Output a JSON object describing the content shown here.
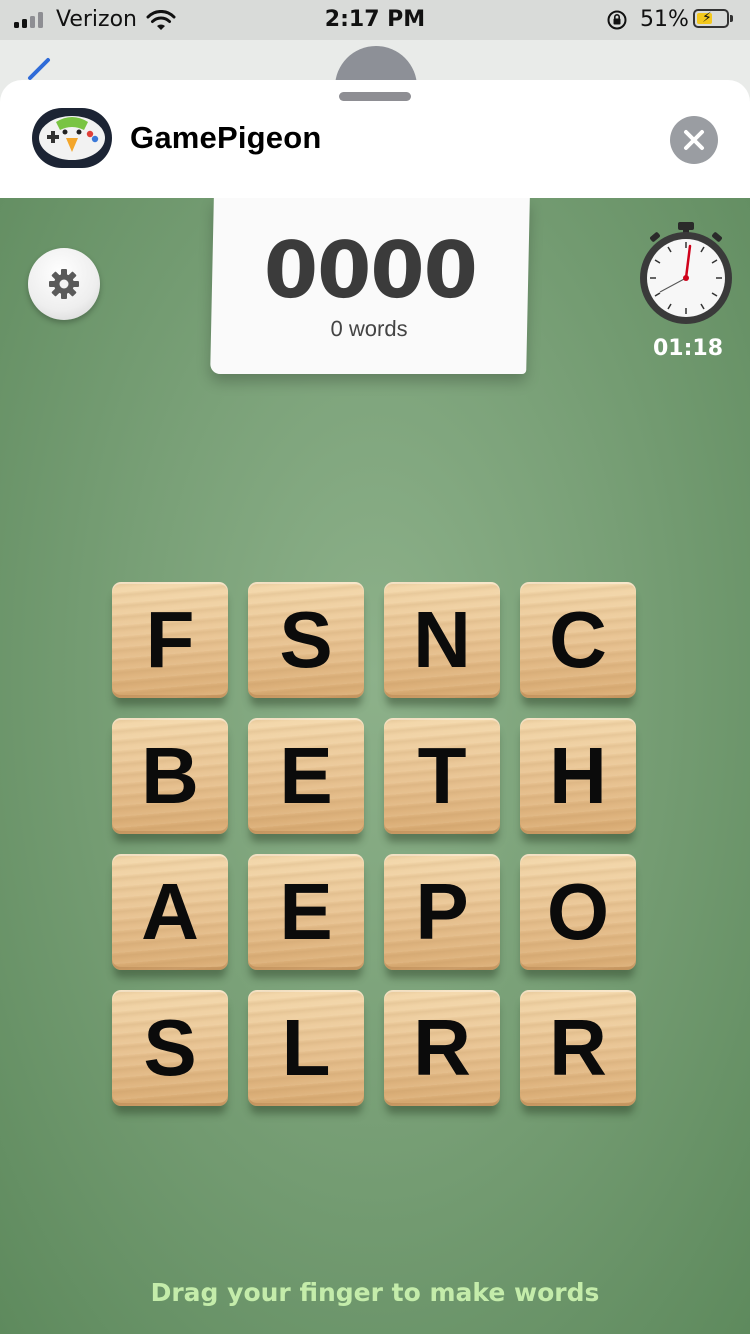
{
  "status_bar": {
    "carrier": "Verizon",
    "time": "2:17 PM",
    "battery_percent": "51%",
    "icons": [
      "signal-icon",
      "wifi-icon",
      "orientation-lock-icon",
      "battery-charging-icon"
    ]
  },
  "sheet": {
    "app_name": "GamePigeon",
    "icons": [
      "gamepigeon-app-icon",
      "close-icon"
    ]
  },
  "game": {
    "score": "0000",
    "word_count": "0 words",
    "timer": "01:18",
    "hint": "Drag your finger to make words",
    "icons": [
      "gear-icon",
      "stopwatch-icon"
    ],
    "board": [
      [
        "F",
        "S",
        "N",
        "C"
      ],
      [
        "B",
        "E",
        "T",
        "H"
      ],
      [
        "A",
        "E",
        "P",
        "O"
      ],
      [
        "S",
        "L",
        "R",
        "R"
      ]
    ]
  },
  "colors": {
    "board_green": "#79a077",
    "tile_wood": "#e7c190",
    "hint_text": "#c4ecaa",
    "timer_hand": "#d0021b"
  }
}
